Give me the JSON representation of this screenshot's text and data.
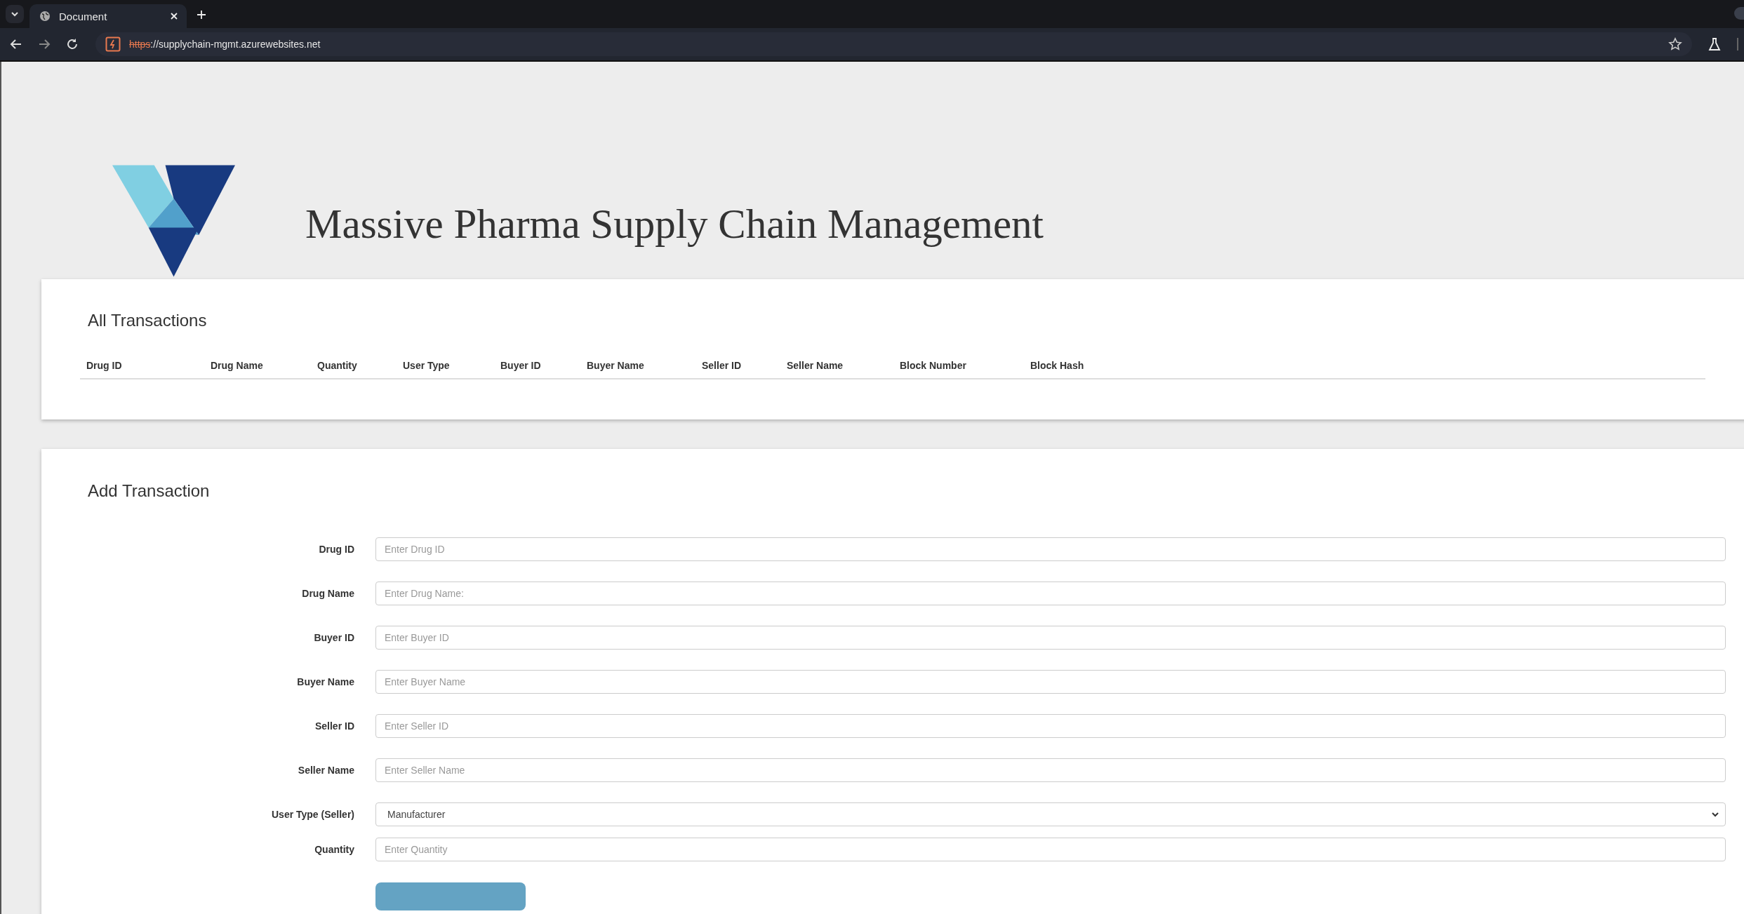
{
  "browser": {
    "tab_title": "Document",
    "url_scheme": "https",
    "url_rest": "://supplychain-mgmt.azurewebsites.net"
  },
  "header": {
    "title": "Massive Pharma Supply Chain Management"
  },
  "transactions": {
    "title": "All Transactions",
    "columns": [
      "Drug ID",
      "Drug Name",
      "Quantity",
      "User Type",
      "Buyer ID",
      "Buyer Name",
      "Seller ID",
      "Seller Name",
      "Block Number",
      "Block Hash"
    ]
  },
  "form": {
    "title": "Add Transaction",
    "fields": [
      {
        "kind": "input",
        "label": "Drug ID",
        "placeholder": "Enter Drug ID"
      },
      {
        "kind": "input",
        "label": "Drug Name",
        "placeholder": "Enter Drug Name:"
      },
      {
        "kind": "input",
        "label": "Buyer ID",
        "placeholder": "Enter Buyer ID"
      },
      {
        "kind": "input",
        "label": "Buyer Name",
        "placeholder": "Enter Buyer Name"
      },
      {
        "kind": "input",
        "label": "Seller ID",
        "placeholder": "Enter Seller ID"
      },
      {
        "kind": "input",
        "label": "Seller Name",
        "placeholder": "Enter Seller Name"
      },
      {
        "kind": "select",
        "label": "User Type (Seller)",
        "value": "Manufacturer"
      },
      {
        "kind": "input",
        "label": "Quantity",
        "placeholder": "Enter Quantity"
      }
    ]
  }
}
